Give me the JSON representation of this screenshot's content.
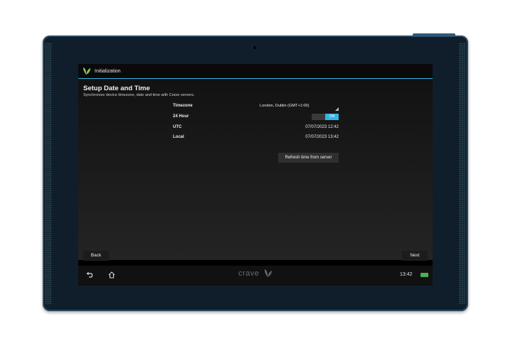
{
  "app": {
    "title": "Initialization"
  },
  "page": {
    "title": "Setup Date and Time",
    "subtitle": "Synchronize device timezone, date and time with Crave servers."
  },
  "settings": {
    "timezone": {
      "label": "Timezone",
      "value": "London, Dublin (GMT+1:00)"
    },
    "hour24": {
      "label": "24 Hour",
      "state": "ON",
      "on": true
    },
    "utc": {
      "label": "UTC",
      "value": "07/07/2023 12:42"
    },
    "local": {
      "label": "Local",
      "value": "07/07/2023 13:42"
    },
    "refresh_label": "Refresh time from server"
  },
  "nav": {
    "back_label": "Back",
    "next_label": "Next"
  },
  "system_bar": {
    "brand": "crave",
    "time": "13:42",
    "icons": [
      "back-icon",
      "home-icon",
      "battery-icon"
    ]
  },
  "colors": {
    "accent": "#33b5e5",
    "battery": "#4caf50",
    "tablet_frame": "#0f1e2a"
  }
}
